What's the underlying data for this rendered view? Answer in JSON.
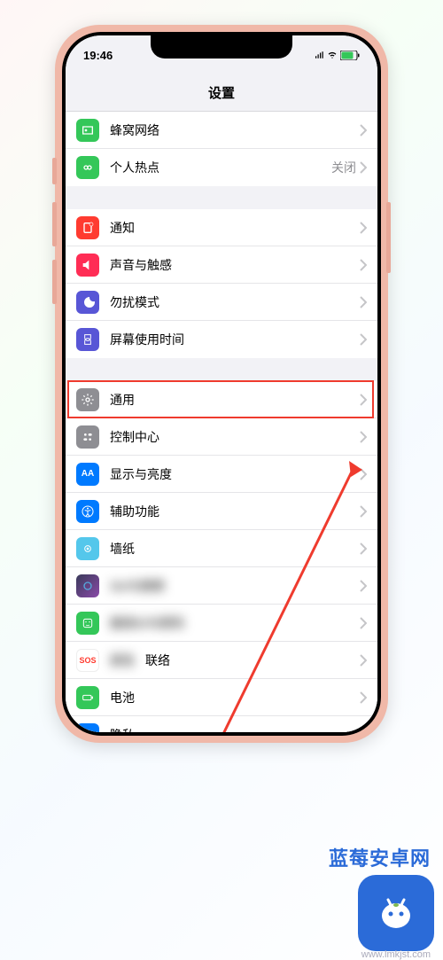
{
  "status": {
    "time": "19:46"
  },
  "nav": {
    "title": "设置"
  },
  "groups": {
    "g1": {
      "cellular": {
        "label": "蜂窝网络",
        "icon_color": "#34c759"
      },
      "hotspot": {
        "label": "个人热点",
        "detail": "关闭",
        "icon_color": "#34c759"
      }
    },
    "g2": {
      "notify": {
        "label": "通知",
        "icon_color": "#ff3b30"
      },
      "sounds": {
        "label": "声音与触感",
        "icon_color": "#ff2d55"
      },
      "dnd": {
        "label": "勿扰模式",
        "icon_color": "#5856d6"
      },
      "screentime": {
        "label": "屏幕使用时间",
        "icon_color": "#5856d6"
      }
    },
    "g3": {
      "general": {
        "label": "通用",
        "icon_color": "#8e8e93"
      },
      "control": {
        "label": "控制中心",
        "icon_color": "#8e8e93"
      },
      "display": {
        "label": "显示与亮度",
        "icon_color": "#007aff"
      },
      "access": {
        "label": "辅助功能",
        "icon_color": "#007aff"
      },
      "wallpaper": {
        "label": "墙纸",
        "icon_color": "#54c7eb"
      },
      "siri": {
        "label": "Siri与搜索",
        "icon_color": "#1f1f2b"
      },
      "face": {
        "label": "面容ID与密码",
        "icon_color": "#34c759"
      },
      "sos": {
        "label": "SOS 紧急联络",
        "icon_color": "#ffffff",
        "text_color": "#ff3b30",
        "sos_text": "SOS"
      },
      "battery": {
        "label": "电池",
        "icon_color": "#34c759"
      },
      "privacy": {
        "label": "隐私",
        "icon_color": "#007aff"
      }
    }
  },
  "watermark": {
    "brand": "蓝莓安卓网",
    "url": "www.lmkjst.com"
  }
}
